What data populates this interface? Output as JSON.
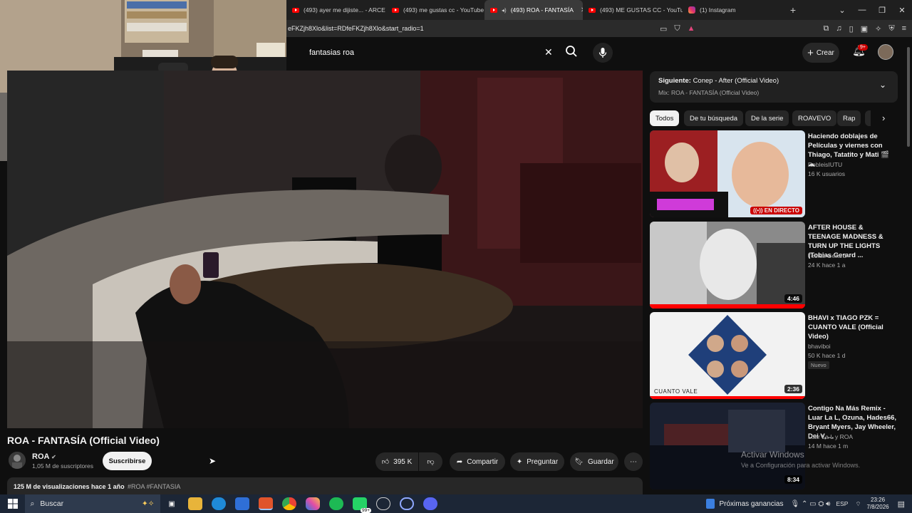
{
  "browser": {
    "tabs": [
      {
        "label": "(493) ayer me dijiste... - ARCE",
        "icon": "youtube-favicon"
      },
      {
        "label": "(493) me gustas cc - YouTube",
        "icon": "youtube-favicon"
      },
      {
        "label": "(493) ROA - FANTASÍA",
        "icon": "youtube-favicon",
        "active": true
      },
      {
        "label": "(493) ME GUSTAS CC - YouTu",
        "icon": "youtube-favicon"
      },
      {
        "label": "(1) Instagram",
        "icon": "instagram-favicon"
      }
    ],
    "new_tab": "+",
    "url": "eFKZjh8Xlo&list=RDfeFKZjh8Xlo&start_radio=1"
  },
  "youtube_header": {
    "search_value": "fantasias roa",
    "create_label": "Crear",
    "notification_badge": "9+"
  },
  "video": {
    "title": "ROA - FANTASÍA (Official Video)",
    "channel": "ROA",
    "subscribers": "1,05 M de suscriptores",
    "subscribe_label": "Suscribirse",
    "likes": "395 K",
    "share_label": "Compartir",
    "ask_label": "Preguntar",
    "save_label": "Guardar",
    "description_meta": "125 M de visualizaciones  hace 1 año",
    "hashtags": "#ROA #FANTASIA"
  },
  "sidebar": {
    "next_prefix": "Siguiente:",
    "next_title": "Conep - After (Official Video)",
    "mix_label": "Mix: ROA - FANTASÍA (Official Video)",
    "filters": [
      "Todos",
      "De tu búsqueda",
      "De la serie",
      "ROAVEVO",
      "Rap"
    ],
    "recommendations": [
      {
        "title": "Haciendo doblajes de Películas y viernes con Thiago, Tatatito y Mati 🎬 ☁",
        "channel": "RobleisIUTU",
        "meta": "16 K usuarios",
        "live_label": "EN DIRECTO"
      },
      {
        "title": "AFTER HOUSE & TEENAGE MADNESS & TURN UP THE LIGHTS (Tobias Gerard ...",
        "channel": "Tobias Gerard",
        "meta": "24 K  hace 1 a",
        "duration": "4:46"
      },
      {
        "title": "BHAVI x TIAGO PZK = CUANTO VALE (Official Video)",
        "channel": "bhaviboi",
        "meta": "50 K  hace 1 d",
        "badge": "Nuevo",
        "duration": "2:36",
        "thumb_text": "CUANTO VALE"
      },
      {
        "title": "Contigo Na Más Remix - Luar La L, Ozuna, Hades66, Bryant Myers, Jay Wheeler, Dei V, ...",
        "channel": "Luar La L  y ROA",
        "meta": "14 M  hace 1 m",
        "duration": "8:34"
      }
    ]
  },
  "watermark": {
    "line1": "Activar Windows",
    "line2": "Ve a Configuración para activar Windows."
  },
  "taskbar": {
    "search_placeholder": "Buscar",
    "widget_label": "Próximas ganancias",
    "lang": "ESP",
    "time": "23:26",
    "date": "7/8/2026",
    "spotify_badge": "99+"
  }
}
